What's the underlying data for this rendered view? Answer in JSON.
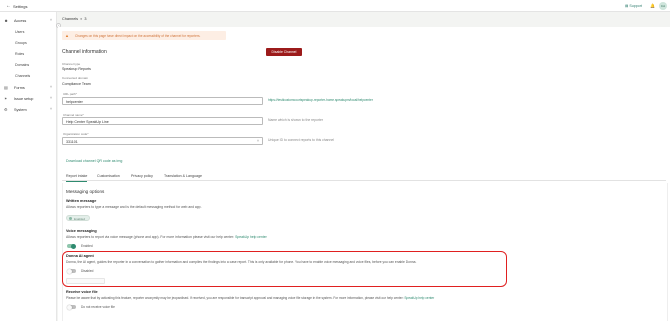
{
  "topbar": {
    "back_icon": "arrow-left-icon",
    "title": "Settings",
    "support": "Support",
    "avatar_initials": "CA"
  },
  "sidebar": {
    "items": [
      {
        "label": "Access",
        "icon": "people-icon"
      },
      {
        "label": "Users"
      },
      {
        "label": "Groups"
      },
      {
        "label": "Roles"
      },
      {
        "label": "Domains"
      },
      {
        "label": "Channels"
      },
      {
        "label": "Forms",
        "icon": "document-icon"
      },
      {
        "label": "Issue setup",
        "icon": "bug-icon"
      },
      {
        "label": "System",
        "icon": "gear-icon"
      }
    ]
  },
  "breadcrumb": {
    "root": "Channels",
    "current": "3"
  },
  "banner": {
    "text": "Changes on this page have direct impact on the accessibility of the channel for reporters."
  },
  "channel_info": {
    "heading": "Channel information",
    "disable_button": "Disable Channel",
    "channel_type_label": "Channel type",
    "channel_type_value": "Speakrup Reports",
    "connected_domain_label": "Connected domain",
    "connected_domain_value": "Compliance Team",
    "url_label": "URL path*",
    "url_value": "helpcenter",
    "url_link": "https://testlcustomcourtspeakup-reporter-home.speakupm/local/helpcenter",
    "channel_name_label": "Channel name*",
    "channel_name_value": "Help Center SpeakUp Line",
    "channel_name_hint": "Name which is shown to the reporter",
    "org_code_label": "Organization code*",
    "org_code_value": "331101",
    "org_code_hint": "Unique ID to connect reports to this channel",
    "download_link": "Download channel QR code as img"
  },
  "tabs": [
    {
      "label": "Report intake",
      "active": true
    },
    {
      "label": "Customisation",
      "active": false
    },
    {
      "label": "Privacy policy",
      "active": false
    },
    {
      "label": "Translation & Language",
      "active": false
    }
  ],
  "messaging": {
    "heading": "Messaging options",
    "written": {
      "title": "Written message",
      "desc": "Allows reporters to type a message and is the default messaging method for web and app.",
      "chip": "Enabled"
    },
    "voice": {
      "title": "Voice messaging",
      "desc_prefix": "Allows reporters to report via voice message (phone and app). For more information please visit our help center:",
      "link": "SpeakUp help center",
      "toggle_label": "Enabled",
      "enabled": true
    },
    "ai_agent": {
      "title": "Donna AI agent",
      "desc": "Donna, the AI agent, guides the reporter in a conversation to gather information and compiles the findings into a case report. This is only available for phone. You have to enable voice messaging and voice files, before you can enable Donna.",
      "toggle_label": "Disabled",
      "enabled": false
    },
    "voice_file": {
      "title": "Receive voice file",
      "desc_prefix": "Please be aware that by activating this feature, reporter anonymity may be jeopardised. If received, you are responsible for transcript approval and managing voice file storage in the system. For more information, please visit our help center:",
      "link": "SpeakUp help center",
      "toggle_label": "Do not receive voice file",
      "enabled": false
    }
  },
  "colors": {
    "accent": "#2e8a6f",
    "danger": "#9c1b1b",
    "highlight": "#e02020",
    "warning_bg": "#fdeee4"
  }
}
